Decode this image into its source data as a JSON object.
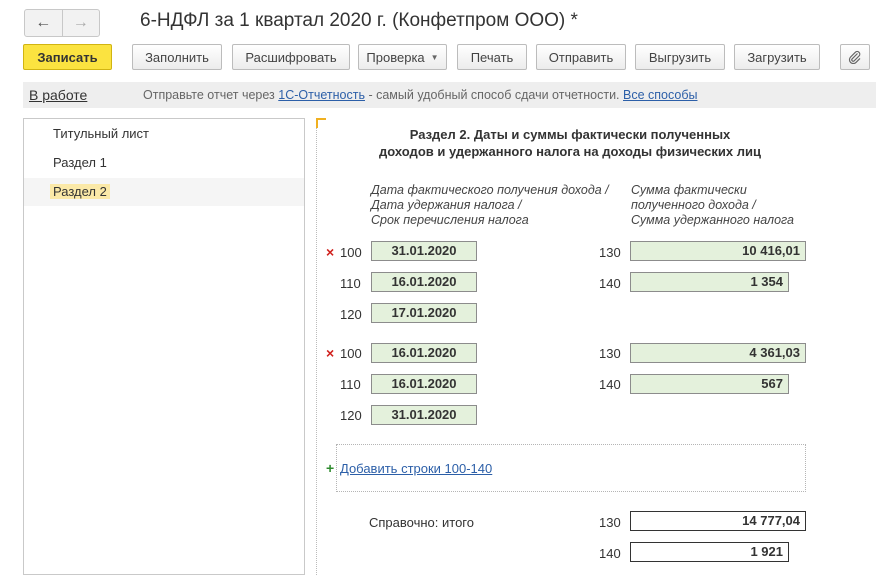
{
  "window": {
    "title": "6-НДФЛ за 1 квартал 2020 г. (Конфетпром ООО) *",
    "back_icon": "←",
    "forward_icon": "→"
  },
  "toolbar": {
    "save": "Записать",
    "fill": "Заполнить",
    "decode": "Расшифровать",
    "check": "Проверка",
    "print": "Печать",
    "send": "Отправить",
    "export": "Выгрузить",
    "import": "Загрузить",
    "attach_icon": "paperclip-icon"
  },
  "infobar": {
    "status": "В работе",
    "text_prefix": "Отправьте отчет через",
    "link_1c": "1С-Отчетность",
    "text_suffix": "- самый удобный способ сдачи отчетности.",
    "link_all": "Все способы"
  },
  "sidebar": {
    "items": [
      {
        "label": "Титульный лист"
      },
      {
        "label": "Раздел 1"
      },
      {
        "label": "Раздел 2"
      }
    ]
  },
  "form": {
    "title_line1": "Раздел 2.  Даты и суммы фактически полученных",
    "title_line2": "доходов и удержанного налога на доходы физических лиц",
    "hdr_dates_1": "Дата фактического получения дохода /",
    "hdr_dates_2": "Дата удержания налога /",
    "hdr_dates_3": "Срок перечисления налога",
    "hdr_sums_1": "Сумма фактически",
    "hdr_sums_2": "полученного дохода /",
    "hdr_sums_3": "Сумма удержанного налога",
    "blocks": [
      {
        "x_mark": "×",
        "code_100": "100",
        "val_100": "31.01.2020",
        "code_110": "110",
        "val_110": "16.01.2020",
        "code_120": "120",
        "val_120": "17.01.2020",
        "code_130": "130",
        "val_130": "10 416,01",
        "code_140": "140",
        "val_140": "1 354"
      },
      {
        "x_mark": "×",
        "code_100": "100",
        "val_100": "16.01.2020",
        "code_110": "110",
        "val_110": "16.01.2020",
        "code_120": "120",
        "val_120": "31.01.2020",
        "code_130": "130",
        "val_130": "4 361,03",
        "code_140": "140",
        "val_140": "567"
      }
    ],
    "add_plus": "+",
    "add_rows": "Добавить строки 100-140",
    "total_label": "Справочно: итого",
    "total_code_130": "130",
    "total_130": "14 777,04",
    "total_code_140": "140",
    "total_140": "1 921"
  }
}
